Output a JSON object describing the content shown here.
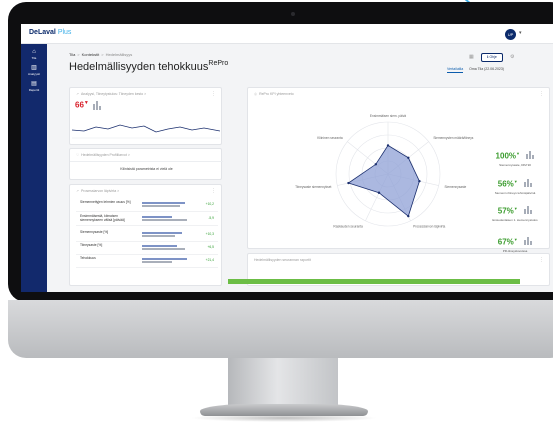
{
  "brand": {
    "name": "DeLaval",
    "suffix": "Plus"
  },
  "user": {
    "initials": "UP"
  },
  "sidebar": {
    "items": [
      {
        "label": "Tila",
        "icon": "home-icon"
      },
      {
        "label": "Analyysit",
        "icon": "chart-icon"
      },
      {
        "label": "Raportit",
        "icon": "report-icon"
      }
    ]
  },
  "breadcrumb": {
    "items": [
      "Tila",
      "Kontekstit",
      "Hedelmällisyys"
    ]
  },
  "page": {
    "title": "Hedelmällisyyden tehokkuus",
    "title_sup": "RePro"
  },
  "header": {
    "help_label": "Ohje",
    "help_icon": "info-icon"
  },
  "tabs": [
    {
      "label": "Vertailutila"
    },
    {
      "label": "Oma Tila (22.06.2023)"
    }
  ],
  "cards": {
    "analysis": {
      "title": "Analyysi, Tiineytystulos: Tiineyden kesto",
      "value": "66",
      "trend": "▼"
    },
    "fertility": {
      "title": "Hedelmällisyyden Profiiliarvot",
      "message": "Kliinisistä parametrista ei vielä ole"
    },
    "metrics": {
      "title": "Prosessiarvon läpivirta",
      "rows": [
        {
          "label": "Siemennettyjen lehmien osuus [%]",
          "value": "+10,2",
          "bar1": 0.85,
          "bar2": 0.75
        },
        {
          "label": "Ensimmäisestä, kiimaisen siemennykseen välisä [päivää]",
          "value": "-5,9",
          "bar1": 0.6,
          "bar2": 0.9
        },
        {
          "label": "Siemennysaste [%]",
          "value": "+10,3",
          "bar1": 0.8,
          "bar2": 0.65
        },
        {
          "label": "Tiineysaste [%]",
          "value": "+6,5",
          "bar1": 0.7,
          "bar2": 0.85
        },
        {
          "label": "Tehokkuus",
          "value": "+21,4",
          "bar1": 0.9,
          "bar2": 0.6
        }
      ]
    },
    "kpi_panel": {
      "title": "RePro KPI yhteenveto"
    },
    "bottom": {
      "title": "Hedelmällisyyden seurannan raportit"
    }
  },
  "radar": {
    "axes": [
      {
        "label": "Ensimmäisen siem. päivä",
        "value": 0.55
      },
      {
        "label": "Siemennysten määrä/tiineys",
        "value": 0.5
      },
      {
        "label": "Siemennysaste",
        "value": 0.62
      },
      {
        "label": "Prosessiarvon läpivirta",
        "value": 0.9
      },
      {
        "label": "Raskauden seuranta",
        "value": 0.4
      },
      {
        "label": "Tiineysaste siemennykset",
        "value": 0.78
      },
      {
        "label": "Kliininen seuranta",
        "value": 0.3
      }
    ]
  },
  "kpis": [
    {
      "value": "100%",
      "trend": "▼",
      "label": "Siemennysaste, DIM 90"
    },
    {
      "value": "56%",
      "trend": "▼",
      "label": "Siemenn./tiineys lehmäpäivinä"
    },
    {
      "value": "57%",
      "trend": "▼",
      "label": "Ensiedenlaisen 1. siemennystulos"
    },
    {
      "value": "67%",
      "trend": "▼",
      "label": "PR-tiineysluvuissa"
    }
  ],
  "colors": {
    "navy": "#12296c",
    "green": "#3b9c2e",
    "red": "#d81f2a",
    "radar_fill": "#8fa0d6"
  }
}
